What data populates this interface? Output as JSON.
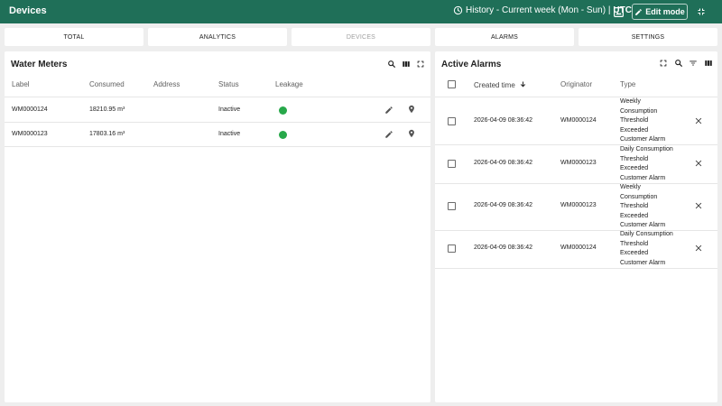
{
  "header": {
    "title": "Devices",
    "history_label": "History - Current week (Mon - Sun) |",
    "timezone": "UTC",
    "edit_mode_label": "Edit mode",
    "accent_color": "#1f6f58"
  },
  "tabs": [
    {
      "label": "TOTAL",
      "state": "normal"
    },
    {
      "label": "ANALYTICS",
      "state": "normal"
    },
    {
      "label": "DEVICES",
      "state": "disabled"
    },
    {
      "label": "ALARMS",
      "state": "normal"
    },
    {
      "label": "SETTINGS",
      "state": "normal"
    }
  ],
  "water_meters": {
    "title": "Water Meters",
    "columns": [
      "Label",
      "Consumed",
      "Address",
      "Status",
      "Leakage"
    ],
    "rows": [
      {
        "label": "WM0000124",
        "consumed": "18210.95 m³",
        "address": "",
        "status": "Inactive",
        "leakage_color": "#27a84a"
      },
      {
        "label": "WM0000123",
        "consumed": "17803.16 m³",
        "address": "",
        "status": "Inactive",
        "leakage_color": "#27a84a"
      }
    ]
  },
  "active_alarms": {
    "title": "Active Alarms",
    "columns": [
      "Created time",
      "Originator",
      "Type"
    ],
    "rows": [
      {
        "created_time": "2026-04-09 08:36:42",
        "originator": "WM0000124",
        "type_lines": [
          "Weekly",
          "Consumption",
          "Threshold",
          "Exceeded",
          "Customer Alarm"
        ]
      },
      {
        "created_time": "2026-04-09 08:36:42",
        "originator": "WM0000123",
        "type_lines": [
          "Daily Consumption",
          "Threshold",
          "Exceeded",
          "Customer Alarm"
        ]
      },
      {
        "created_time": "2026-04-09 08:36:42",
        "originator": "WM0000123",
        "type_lines": [
          "Weekly",
          "Consumption",
          "Threshold",
          "Exceeded",
          "Customer Alarm"
        ]
      },
      {
        "created_time": "2026-04-09 08:36:42",
        "originator": "WM0000124",
        "type_lines": [
          "Daily Consumption",
          "Threshold",
          "Exceeded",
          "Customer Alarm"
        ]
      }
    ]
  }
}
